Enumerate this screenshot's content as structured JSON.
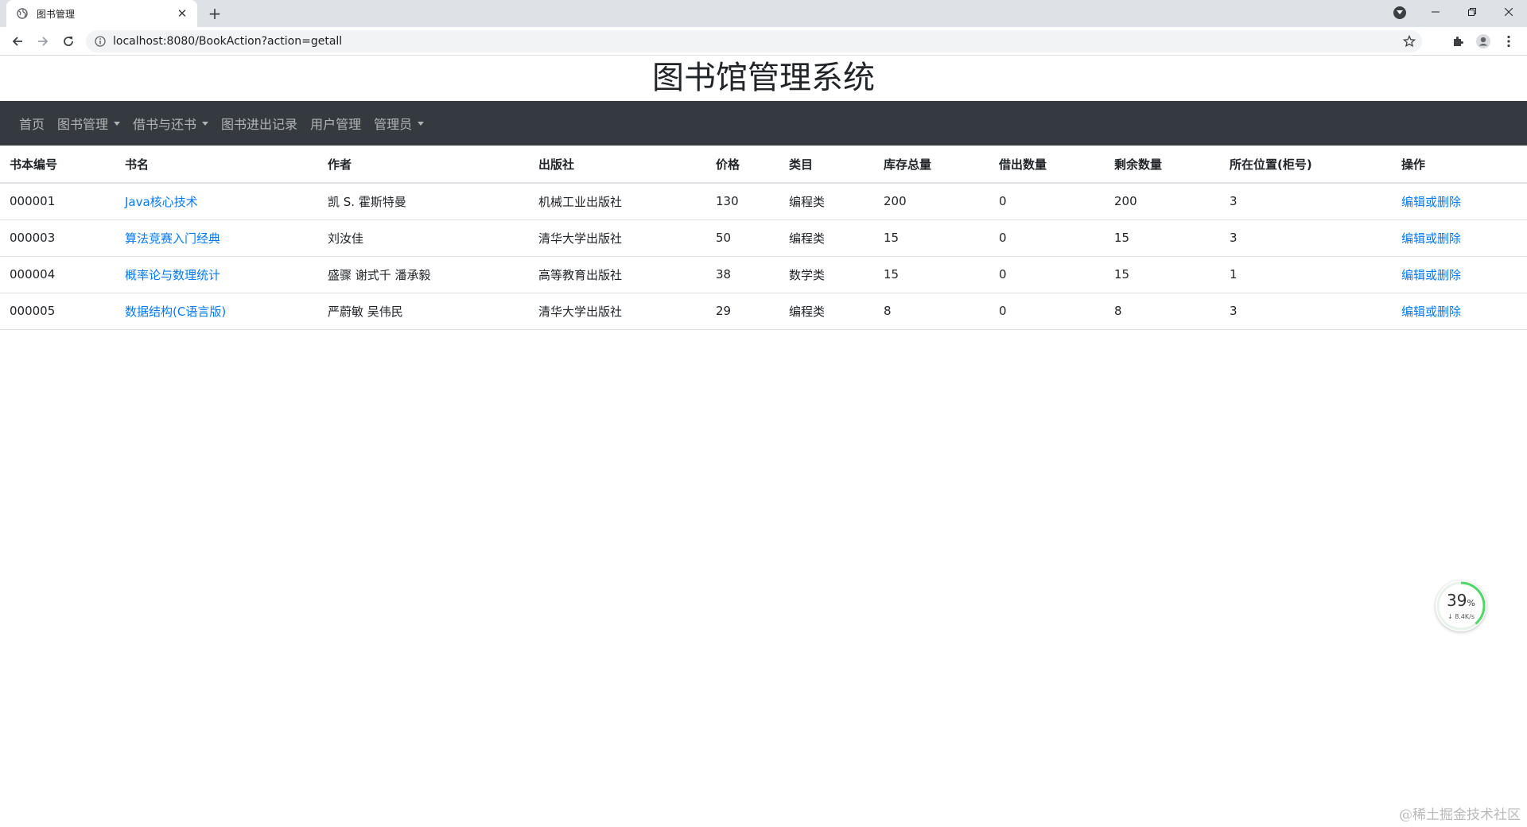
{
  "browser": {
    "tab_title": "图书管理",
    "url": "localhost:8080/BookAction?action=getall",
    "window_controls": [
      "minimize-icon",
      "restore-icon",
      "close-icon"
    ]
  },
  "page": {
    "title": "图书馆管理系统"
  },
  "nav": {
    "items": [
      {
        "label": "首页",
        "dropdown": false
      },
      {
        "label": "图书管理",
        "dropdown": true
      },
      {
        "label": "借书与还书",
        "dropdown": true
      },
      {
        "label": "图书进出记录",
        "dropdown": false
      },
      {
        "label": "用户管理",
        "dropdown": false
      },
      {
        "label": "管理员",
        "dropdown": true
      }
    ]
  },
  "table": {
    "headers": [
      "书本编号",
      "书名",
      "作者",
      "出版社",
      "价格",
      "类目",
      "库存总量",
      "借出数量",
      "剩余数量",
      "所在位置(柜号)",
      "操作"
    ],
    "rows": [
      [
        "000001",
        "Java核心技术",
        "凯 S. 霍斯特曼",
        "机械工业出版社",
        "130",
        "编程类",
        "200",
        "0",
        "200",
        "3",
        "编辑或删除"
      ],
      [
        "000003",
        "算法竞赛入门经典",
        "刘汝佳",
        "清华大学出版社",
        "50",
        "编程类",
        "15",
        "0",
        "15",
        "3",
        "编辑或删除"
      ],
      [
        "000004",
        "概率论与数理统计",
        "盛骤 谢式千 潘承毅",
        "高等教育出版社",
        "38",
        "数学类",
        "15",
        "0",
        "15",
        "1",
        "编辑或删除"
      ],
      [
        "000005",
        "数据结构(C语言版)",
        "严蔚敏 吴伟民",
        "清华大学出版社",
        "29",
        "编程类",
        "8",
        "0",
        "8",
        "3",
        "编辑或删除"
      ]
    ]
  },
  "net_monitor": {
    "percent": "39",
    "percent_unit": "%",
    "percent_value": 0.39,
    "speed": "↓ 8.4K/s"
  },
  "watermark": "@稀土掘金技术社区",
  "colors": {
    "navbar": "#343a40",
    "link": "#007bff",
    "ring": "#4cd964"
  }
}
